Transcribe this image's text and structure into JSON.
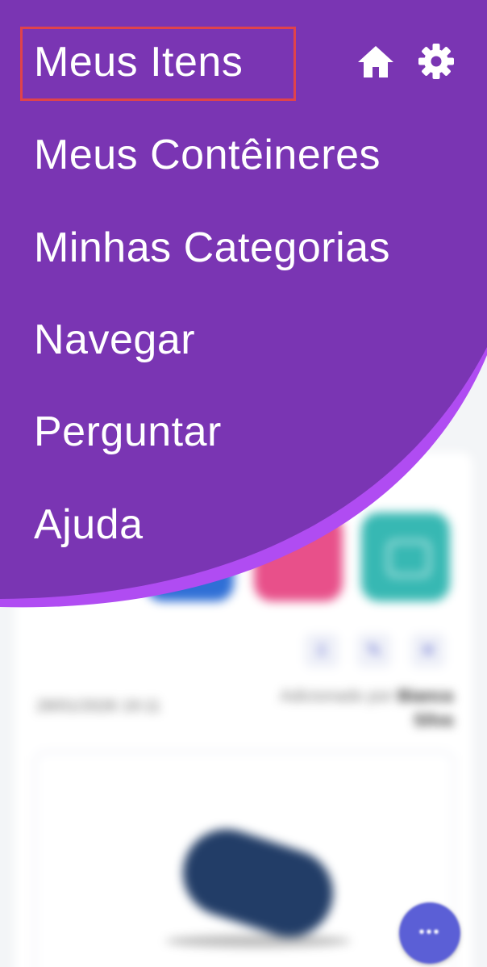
{
  "menu": {
    "items": [
      {
        "label": "Meus Itens",
        "highlighted": true
      },
      {
        "label": "Meus Contêineres"
      },
      {
        "label": "Minhas Categorias"
      },
      {
        "label": "Navegar"
      },
      {
        "label": "Perguntar"
      },
      {
        "label": "Ajuda"
      }
    ],
    "icons": {
      "home": "home-icon",
      "settings": "gear-icon"
    }
  },
  "background": {
    "item_date": "28/01/2026 19:11",
    "added_by_prefix": "Adicionado por",
    "added_by_name": "Bianca Silva",
    "action_icons": [
      "download-icon",
      "edit-icon",
      "delete-icon"
    ]
  },
  "colors": {
    "menu_purple": "#7a35b3",
    "accent_purple": "#b04cf2",
    "highlight_red": "#e0434b",
    "fab_blue": "#5b5fd6"
  }
}
